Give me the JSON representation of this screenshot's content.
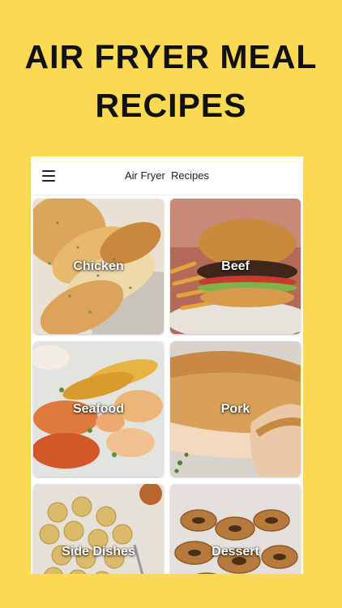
{
  "promo": {
    "line1": "AIR FRYER MEAL",
    "line2": "RECIPES"
  },
  "app": {
    "title": "Air Fryer  Recipes",
    "menu_icon": "hamburger-menu-icon"
  },
  "categories": [
    {
      "label": "Chicken"
    },
    {
      "label": "Beef"
    },
    {
      "label": "Seafood"
    },
    {
      "label": "Pork"
    },
    {
      "label": "Side Dishes"
    },
    {
      "label": "Dessert"
    }
  ],
  "colors": {
    "background": "#fcd953",
    "card_text": "#ffffff"
  }
}
